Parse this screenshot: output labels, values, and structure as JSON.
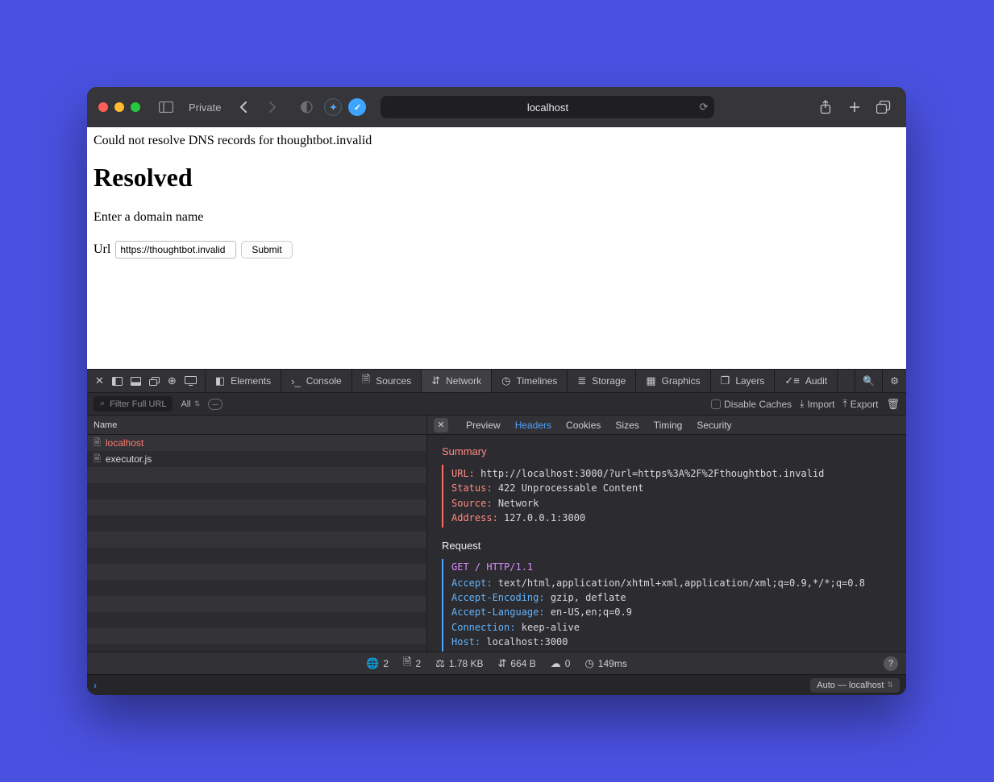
{
  "titlebar": {
    "private_label": "Private",
    "address": "localhost"
  },
  "page": {
    "error_text": "Could not resolve DNS records for thoughtbot.invalid",
    "heading": "Resolved",
    "hint": "Enter a domain name",
    "url_label": "Url",
    "url_value": "https://thoughtbot.invalid",
    "submit_label": "Submit"
  },
  "devtools": {
    "tabs": {
      "elements": "Elements",
      "console": "Console",
      "sources": "Sources",
      "network": "Network",
      "timelines": "Timelines",
      "storage": "Storage",
      "graphics": "Graphics",
      "layers": "Layers",
      "audit": "Audit"
    },
    "toolbar2": {
      "filter_placeholder": "Filter Full URL",
      "all_label": "All",
      "disable_caches": "Disable Caches",
      "import": "Import",
      "export": "Export"
    },
    "left": {
      "col_header": "Name",
      "rows": [
        {
          "name": "localhost",
          "error": true
        },
        {
          "name": "executor.js",
          "error": false
        }
      ]
    },
    "subtabs": {
      "preview": "Preview",
      "headers": "Headers",
      "cookies": "Cookies",
      "sizes": "Sizes",
      "timing": "Timing",
      "security": "Security"
    },
    "summary": {
      "title": "Summary",
      "url_k": "URL:",
      "url_v": "http://localhost:3000/?url=https%3A%2F%2Fthoughtbot.invalid",
      "status_k": "Status:",
      "status_v": "422 Unprocessable Content",
      "source_k": "Source:",
      "source_v": "Network",
      "address_k": "Address:",
      "address_v": "127.0.0.1:3000"
    },
    "request": {
      "title": "Request",
      "line": "GET / HTTP/1.1",
      "headers": [
        {
          "k": "Accept:",
          "v": "text/html,application/xhtml+xml,application/xml;q=0.9,*/*;q=0.8"
        },
        {
          "k": "Accept-Encoding:",
          "v": "gzip, deflate"
        },
        {
          "k": "Accept-Language:",
          "v": "en-US,en;q=0.9"
        },
        {
          "k": "Connection:",
          "v": "keep-alive"
        },
        {
          "k": "Host:",
          "v": "localhost:3000"
        }
      ]
    },
    "status": {
      "globe": "2",
      "doc": "2",
      "weight": "1.78 KB",
      "transfer": "664 B",
      "cloud": "0",
      "time": "149ms"
    },
    "console": {
      "context": "Auto — localhost"
    }
  }
}
